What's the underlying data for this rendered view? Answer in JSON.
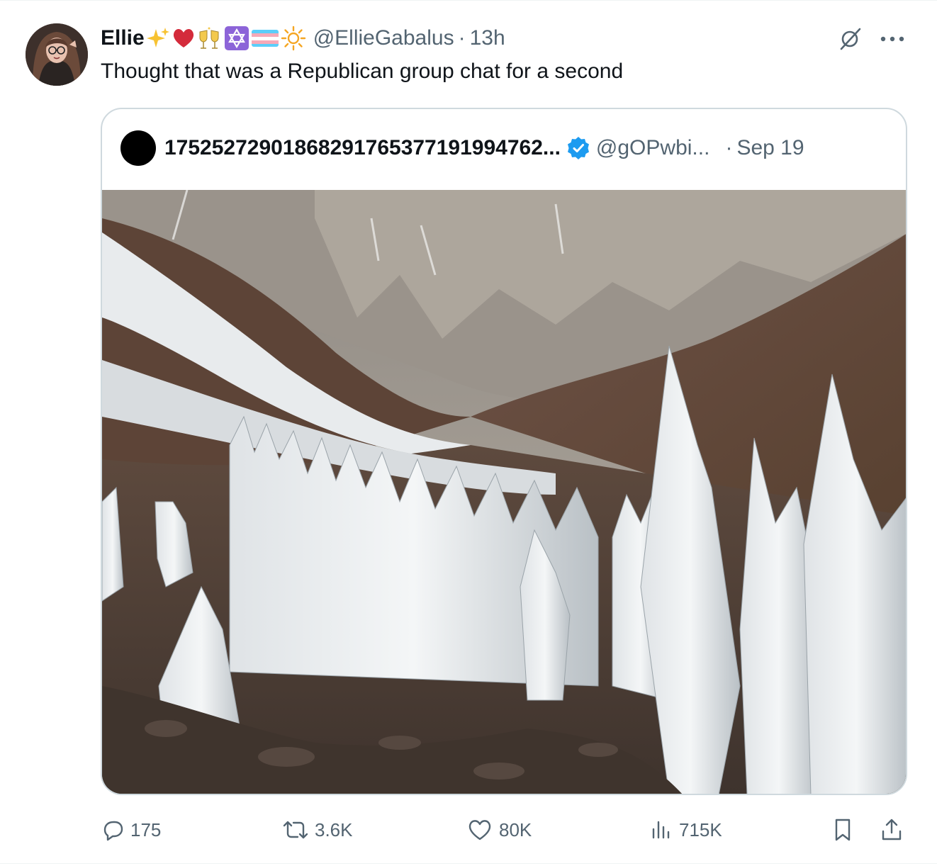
{
  "tweet": {
    "display_name": "Ellie",
    "handle": "@EllieGabalus",
    "separator": "·",
    "time": "13h",
    "text": "Thought that was a Republican group chat for a second",
    "name_emojis": [
      "sparkles-icon",
      "red-heart-icon",
      "clinking-glasses-icon",
      "star-of-david-icon",
      "transgender-flag-icon",
      "sun-icon"
    ]
  },
  "quote": {
    "display_name": "17525272901868291765377191994762...",
    "verified": true,
    "handle": "@gOPwbi...",
    "separator": "·",
    "time": "Sep 19",
    "media_icon": "landscape-photo-icon"
  },
  "actions": {
    "replies": "175",
    "reposts": "3.6K",
    "likes": "80K",
    "views": "715K"
  },
  "colors": {
    "text_primary": "#0f1419",
    "text_secondary": "#536471",
    "border": "#cfd9de",
    "verified_blue": "#1d9bf0",
    "heart_red": "#d42b3b"
  }
}
